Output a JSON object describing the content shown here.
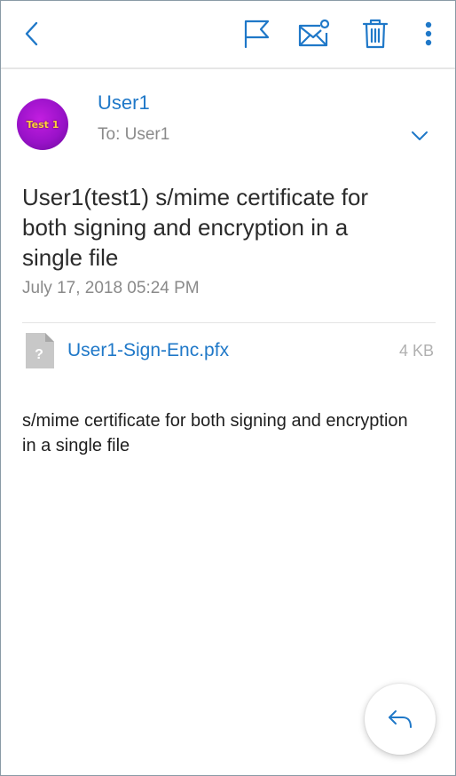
{
  "toolbar": {
    "back_icon": "chevron-left-icon",
    "flag_icon": "flag-icon",
    "mark_unread_icon": "mail-unread-icon",
    "delete_icon": "trash-icon",
    "more_icon": "more-vertical-icon",
    "accent_color": "#1f78c8"
  },
  "message": {
    "avatar_text": "Test 1",
    "sender": "User1",
    "recipient": "To: User1",
    "subject": "User1(test1) s/mime certificate for both signing and encryption in a single file",
    "date": "July 17, 2018 05:24 PM",
    "body": "s/mime certificate for both signing and encryption in a single file"
  },
  "attachment": {
    "icon": "unknown-file-icon",
    "name": "User1-Sign-Enc.pfx",
    "size": "4 KB"
  },
  "fab": {
    "icon": "reply-icon"
  }
}
